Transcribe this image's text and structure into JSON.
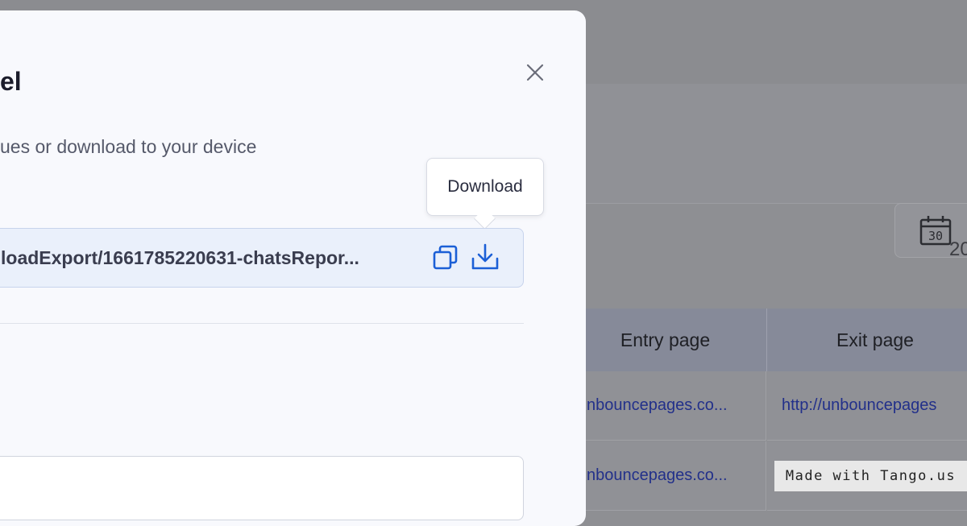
{
  "modal": {
    "title": "el",
    "description": "ues or download to your device",
    "export_url": "loadExport/1661785220631-chatsRepor...",
    "tooltip": "Download"
  },
  "background": {
    "calendar_day": "30",
    "partial_value": "20",
    "table": {
      "headers": [
        "Entry page",
        "Exit page"
      ],
      "rows": [
        [
          "nbouncepages.co...",
          "http://unbouncepages"
        ],
        [
          "nbouncepages.co...",
          ""
        ]
      ]
    }
  },
  "watermark": "Made with Tango.us",
  "colors": {
    "accent": "#1b5fd6",
    "overlay": "#8e8f93",
    "modal_bg": "#f8f9fd"
  }
}
